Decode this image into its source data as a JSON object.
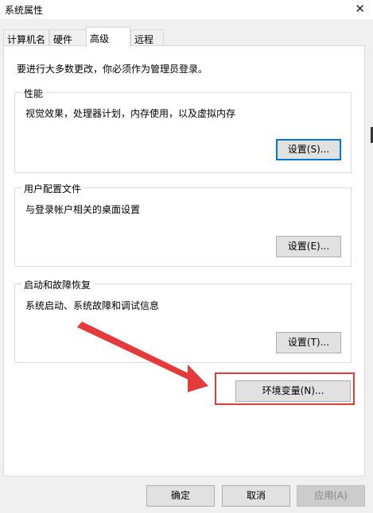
{
  "window": {
    "title": "系统属性",
    "close_glyph": "✕"
  },
  "tabs": [
    {
      "label": "计算机名"
    },
    {
      "label": "硬件"
    },
    {
      "label": "高级",
      "active": true
    },
    {
      "label": "远程"
    }
  ],
  "notice": "要进行大多数更改，你必须作为管理员登录。",
  "performance": {
    "title": "性能",
    "description": "视觉效果，处理器计划，内存使用，以及虚拟内存",
    "button": "设置(S)..."
  },
  "user_profiles": {
    "title": "用户配置文件",
    "description": "与登录帐户相关的桌面设置",
    "button": "设置(E)..."
  },
  "startup_recovery": {
    "title": "启动和故障恢复",
    "description": "系统启动、系统故障和调试信息",
    "button": "设置(T)..."
  },
  "env_button": "环境变量(N)...",
  "footer": {
    "ok": "确定",
    "cancel": "取消",
    "apply": "应用(A)"
  },
  "annotation": {
    "color": "#e53a3a"
  }
}
